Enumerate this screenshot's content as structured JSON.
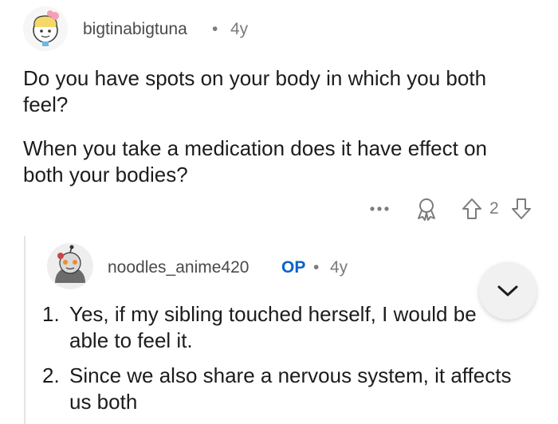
{
  "comment": {
    "username": "bigtinabigtuna",
    "separator": "•",
    "age": "4y",
    "paragraph1": "Do you have spots on your body in which you both feel?",
    "paragraph1_line1": "Do you have spots on your body in which you both",
    "paragraph1_line2": "feel?",
    "paragraph2_line1": "When you take a medication does it have effect on",
    "paragraph2_line2": "both your bodies?",
    "vote_count": "2",
    "more_label": "•••"
  },
  "reply": {
    "username": "noodles_anime420",
    "op_badge": "OP",
    "separator": "•",
    "age": "4y",
    "items": [
      {
        "num": "1.",
        "line1": "Yes, if my sibling touched herself, I would be",
        "line2": "able to feel it."
      },
      {
        "num": "2.",
        "line1": "Since we also share a nervous system, it affects",
        "line2": "us both"
      }
    ]
  },
  "colors": {
    "text": "#1c1c1c",
    "muted": "#7c7c7c",
    "op_blue": "#0a62c9"
  },
  "icons": [
    "avatar-bigtinabigtuna",
    "more-icon",
    "award-icon",
    "upvote-icon",
    "downvote-icon",
    "avatar-noodles",
    "chevron-down-icon"
  ]
}
